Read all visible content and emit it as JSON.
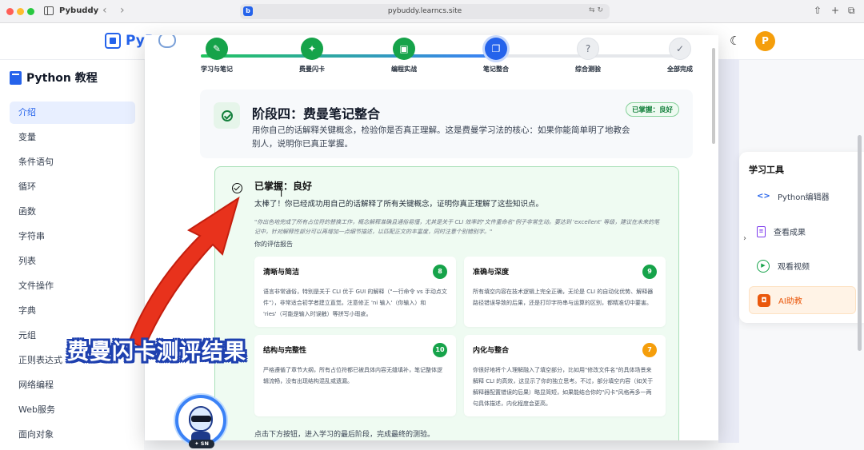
{
  "browser": {
    "tab_title": "Pybuddy",
    "url": "pybuddy.learncs.site"
  },
  "app": {
    "logo_text": "PyB",
    "avatar_letter": "P"
  },
  "left_nav": {
    "heading": "Python 教程",
    "items": [
      "介绍",
      "变量",
      "条件语句",
      "循环",
      "函数",
      "字符串",
      "列表",
      "文件操作",
      "字典",
      "元组",
      "正则表达式",
      "网络编程",
      "Web服务",
      "面向对象"
    ],
    "active_index": 0
  },
  "right_tools": {
    "title": "学习工具",
    "items": [
      {
        "label": "Python编辑器",
        "icon": "code-brackets-icon"
      },
      {
        "label": "查看成果",
        "icon": "document-icon"
      },
      {
        "label": "观看视频",
        "icon": "play-icon"
      },
      {
        "label": "AI助教",
        "icon": "robot-icon"
      }
    ]
  },
  "progress": {
    "fraction": 0.6,
    "steps": [
      {
        "label": "学习与笔记",
        "state": "done",
        "icon": "pencil-icon"
      },
      {
        "label": "费曼闪卡",
        "state": "done",
        "icon": "sparkle-icon"
      },
      {
        "label": "编程实战",
        "state": "done",
        "icon": "terminal-icon"
      },
      {
        "label": "笔记整合",
        "state": "current",
        "icon": "copy-icon"
      },
      {
        "label": "综合测验",
        "state": "todo",
        "icon": "question-icon"
      },
      {
        "label": "全部完成",
        "state": "todo",
        "icon": "check-icon"
      }
    ]
  },
  "stage": {
    "title": "阶段四：费曼笔记整合",
    "description": "用你自己的话解释关键概念，检验你是否真正理解。这是费曼学习法的核心：如果你能简单明了地教会别人，说明你已真正掌握。",
    "badge": "已掌握：良好"
  },
  "result": {
    "title": "已掌握：良好",
    "subtitle": "太棒了！你已经成功用自己的话解释了所有关键概念，证明你真正理解了这些知识点。",
    "quote": "\"你出色地完成了所有占位符的替换工作，概念解释准确且通俗易懂，尤其是关于 CLI 效率的\"文件重命名\"例子非常生动。要达到 'excellent' 等级，建议在未来的笔记中，针对解释性部分可以再增加一点细节描述，以匹配正文的丰富度，同时注意个别错别字。\"",
    "report_label": "你的评估报告",
    "cards": [
      {
        "title": "清晰与简洁",
        "score": "8",
        "score_color": "#16a34a",
        "text": "语言非常通俗，特别是关于 CLI 优于 GUI 的解释（\"一行命令 vs 手动点文件\"），非常适合初学者建立直觉。注意修正 'ni 输入'（你输入）和 'ries'（可能是输入时误触）等拼写小瑕疵。"
      },
      {
        "title": "准确与深度",
        "score": "9",
        "score_color": "#16a34a",
        "text": "所有填空内容在技术逻辑上完全正确，无论是 CLI 的自动化优势、解释器路径错误导致的后果，还是打印字符串与运算的区别，都精准切中要害。"
      },
      {
        "title": "结构与完整性",
        "score": "10",
        "score_color": "#16a34a",
        "text": "严格遵循了章节大纲，所有占位符都已被具体内容无缝填补，笔记整体逻辑流畅，没有出现结构混乱或遗漏。"
      },
      {
        "title": "内化与整合",
        "score": "7",
        "score_color": "#f59e0b",
        "text": "你很好地将个人理解融入了填空部分，比如用\"修改文件名\"的具体场景来解释 CLI 的高效，这显示了你的独立思考。不过，部分填空内容（如关于解释器配置错误的后果）略显简短，如果能结合你的\"闪卡\"风格再多一两句具体描述，内化程度会更高。"
      }
    ],
    "footer": "点击下方按钮，进入学习的最后阶段，完成最终的测验。"
  },
  "overlay": {
    "caption": "费曼闪卡测评结果",
    "badge": "✦ SN",
    "arrow_color": "#e8321c"
  }
}
